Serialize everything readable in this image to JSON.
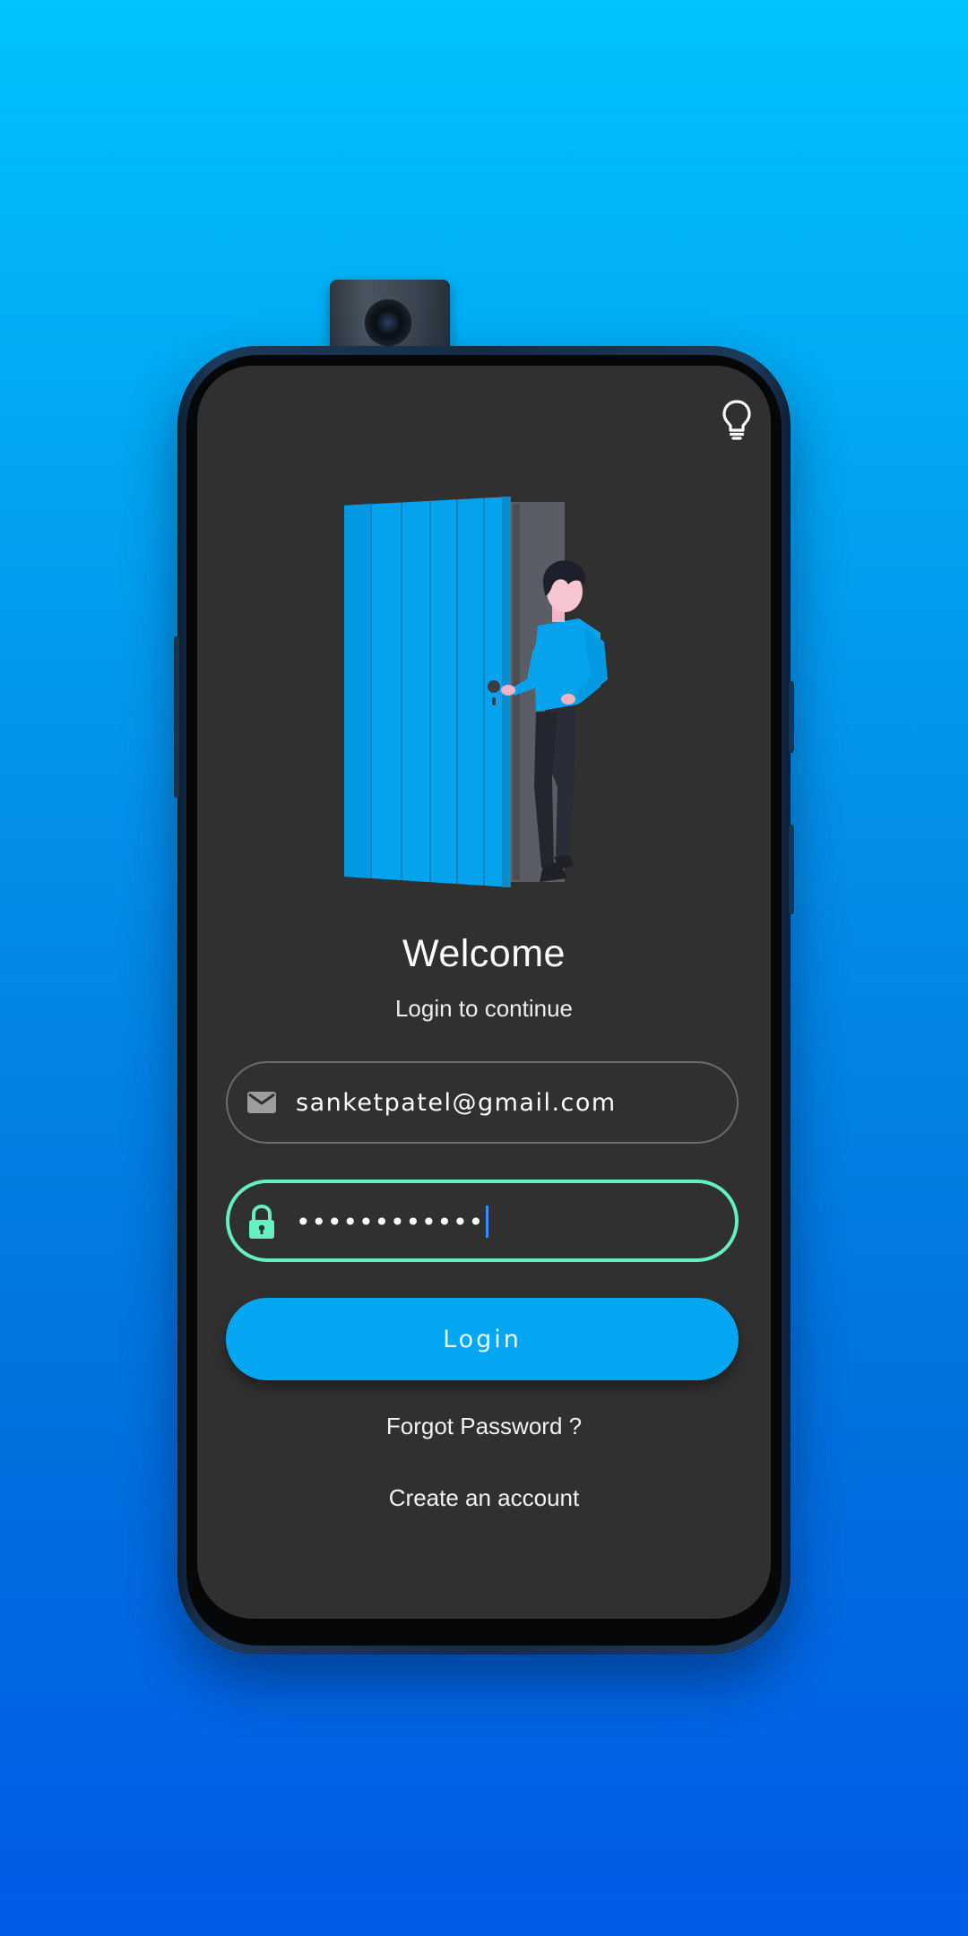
{
  "login": {
    "title": "Welcome",
    "subtitle": "Login to continue",
    "email": {
      "value": "sanketpatel@gmail.com",
      "icon": "mail-icon"
    },
    "password": {
      "masked_value": "••••••••••••",
      "icon": "lock-icon"
    },
    "login_label": "Login",
    "forgot_label": "Forgot Password ?",
    "create_label": "Create an account",
    "theme_icon": "lightbulb-icon"
  },
  "colors": {
    "accent": "#03a7f1",
    "focus_border": "#64f0c0",
    "screen_background": "#303030",
    "page_gradient_top": "#00c2fc",
    "page_gradient_bottom": "#005be6"
  }
}
